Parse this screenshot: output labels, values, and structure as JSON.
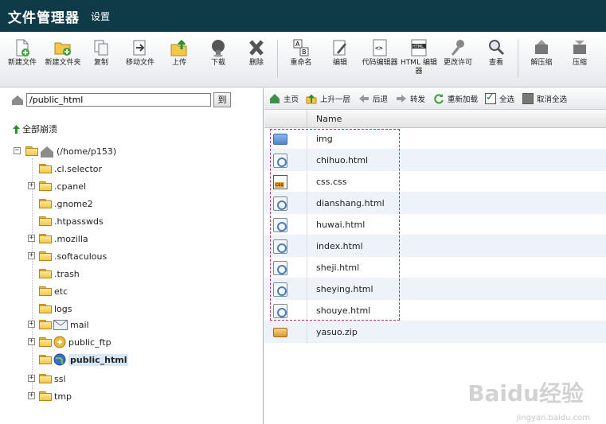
{
  "header": {
    "title": "文件管理器",
    "settings": "设置"
  },
  "toolbar": {
    "buttons": [
      {
        "label": "新建文件",
        "icon": "new-file-icon"
      },
      {
        "label": "新建文件夹",
        "icon": "new-folder-icon"
      },
      {
        "label": "复制",
        "icon": "copy-icon"
      },
      {
        "label": "移动文件",
        "icon": "move-file-icon"
      },
      {
        "label": "上传",
        "icon": "upload-icon"
      },
      {
        "label": "下载",
        "icon": "download-icon"
      },
      {
        "label": "删除",
        "icon": "delete-icon"
      },
      {
        "label": "重命名",
        "icon": "rename-icon"
      },
      {
        "label": "编辑",
        "icon": "edit-icon"
      },
      {
        "label": "代码编辑器",
        "icon": "code-editor-icon"
      },
      {
        "label": "HTML 编辑器",
        "icon": "html-editor-icon"
      },
      {
        "label": "更改许可",
        "icon": "permissions-icon"
      },
      {
        "label": "查看",
        "icon": "view-icon"
      },
      {
        "label": "解压缩",
        "icon": "extract-icon"
      },
      {
        "label": "压缩",
        "icon": "compress-icon"
      }
    ]
  },
  "left": {
    "path_value": "/public_html",
    "go_label": "到",
    "collapse_all": "全部崩溃",
    "tree": {
      "root": "(/home/p153)",
      "items": [
        {
          "label": ".cl.selector",
          "expandable": false
        },
        {
          "label": ".cpanel",
          "expandable": true
        },
        {
          "label": ".gnome2",
          "expandable": false
        },
        {
          "label": ".htpasswds",
          "expandable": false
        },
        {
          "label": ".mozilla",
          "expandable": true
        },
        {
          "label": ".softaculous",
          "expandable": true
        },
        {
          "label": ".trash",
          "expandable": false
        },
        {
          "label": "etc",
          "expandable": false
        },
        {
          "label": "logs",
          "expandable": false
        },
        {
          "label": "mail",
          "expandable": true
        },
        {
          "label": "public_ftp",
          "expandable": true
        },
        {
          "label": "public_html",
          "expandable": false,
          "selected": true
        },
        {
          "label": "ssl",
          "expandable": true
        },
        {
          "label": "tmp",
          "expandable": true
        }
      ]
    }
  },
  "right": {
    "nav": {
      "home": "主页",
      "up": "上升一层",
      "back": "后退",
      "forward": "转发",
      "reload": "重新加载",
      "select_all": "全选",
      "deselect_all": "取消全选"
    },
    "column_name": "Name",
    "files": [
      {
        "name": "img",
        "type": "folder"
      },
      {
        "name": "chihuo.html",
        "type": "html"
      },
      {
        "name": "css.css",
        "type": "css"
      },
      {
        "name": "dianshang.html",
        "type": "html"
      },
      {
        "name": "huwai.html",
        "type": "html"
      },
      {
        "name": "index.html",
        "type": "html"
      },
      {
        "name": "sheji.html",
        "type": "html"
      },
      {
        "name": "sheying.html",
        "type": "html"
      },
      {
        "name": "shouye.html",
        "type": "html"
      },
      {
        "name": "yasuo.zip",
        "type": "zip"
      }
    ]
  },
  "watermark": {
    "main": "Baidu经验",
    "sub": "jingyan.baidu.com"
  }
}
